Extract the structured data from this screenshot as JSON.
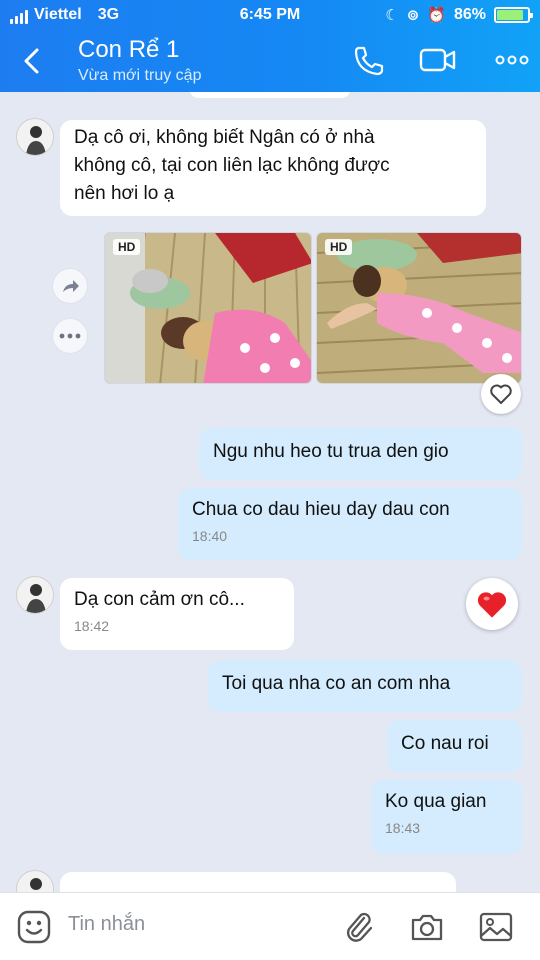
{
  "status_bar": {
    "carrier": "Viettel",
    "network": "3G",
    "time": "6:45 PM",
    "battery": "86%",
    "battery_level": 0.86
  },
  "header": {
    "title": "Con Rể 1",
    "subtitle": "Vừa mới truy cập",
    "accent_color": "#1588f4"
  },
  "messages": [
    {
      "id": "m1",
      "direction": "incoming",
      "text_lines": [
        "Dạ cô ơi, không biết Ngân có ở nhà",
        "không cô, tại con liên lạc không được",
        "nên hơi lo ạ"
      ]
    },
    {
      "id": "m2",
      "direction": "outgoing",
      "type": "photos",
      "badges": [
        "HD",
        "HD"
      ]
    },
    {
      "id": "m3",
      "direction": "outgoing",
      "text": "Ngu nhu heo tu trua den gio"
    },
    {
      "id": "m4",
      "direction": "outgoing",
      "text": "Chua co dau hieu day dau con",
      "time": "18:40"
    },
    {
      "id": "m5",
      "direction": "incoming",
      "text": "Dạ con cảm ơn cô...",
      "time": "18:42"
    },
    {
      "id": "m6",
      "direction": "outgoing",
      "text": "Toi qua nha co an com nha"
    },
    {
      "id": "m7",
      "direction": "outgoing",
      "text": "Co nau roi"
    },
    {
      "id": "m8",
      "direction": "outgoing",
      "text": "Ko qua gian",
      "time": "18:43"
    }
  ],
  "input": {
    "placeholder": "Tin nhắn"
  },
  "icons": {
    "back": "chevron-left-icon",
    "call": "phone-icon",
    "video": "video-icon",
    "more": "more-icon",
    "share": "share-icon",
    "photo_more": "ellipsis-icon",
    "react": "heart-outline-icon",
    "reaction": "heart-filled-icon",
    "sticker": "emoji-icon",
    "attach": "paperclip-icon",
    "camera": "camera-icon",
    "gallery": "image-icon"
  },
  "reaction_color": "#e8202a"
}
